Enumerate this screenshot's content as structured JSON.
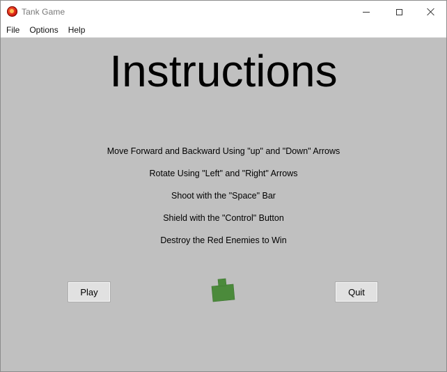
{
  "window": {
    "title": "Tank Game",
    "controls": [
      "minimize",
      "maximize",
      "close"
    ]
  },
  "menubar": {
    "items": [
      "File",
      "Options",
      "Help"
    ]
  },
  "screen": {
    "heading": "Instructions",
    "instructions": [
      "Move Forward and Backward Using \"up\" and \"Down\" Arrows",
      "Rotate Using \"Left\" and \"Right\" Arrows",
      "Shoot with the \"Space\" Bar",
      "Shield with the \"Control\" Button",
      "Destroy the Red Enemies to Win"
    ],
    "buttons": {
      "play": "Play",
      "quit": "Quit"
    },
    "player_tank_color": "#4b8a3b",
    "background_color": "#c0c0c0"
  }
}
